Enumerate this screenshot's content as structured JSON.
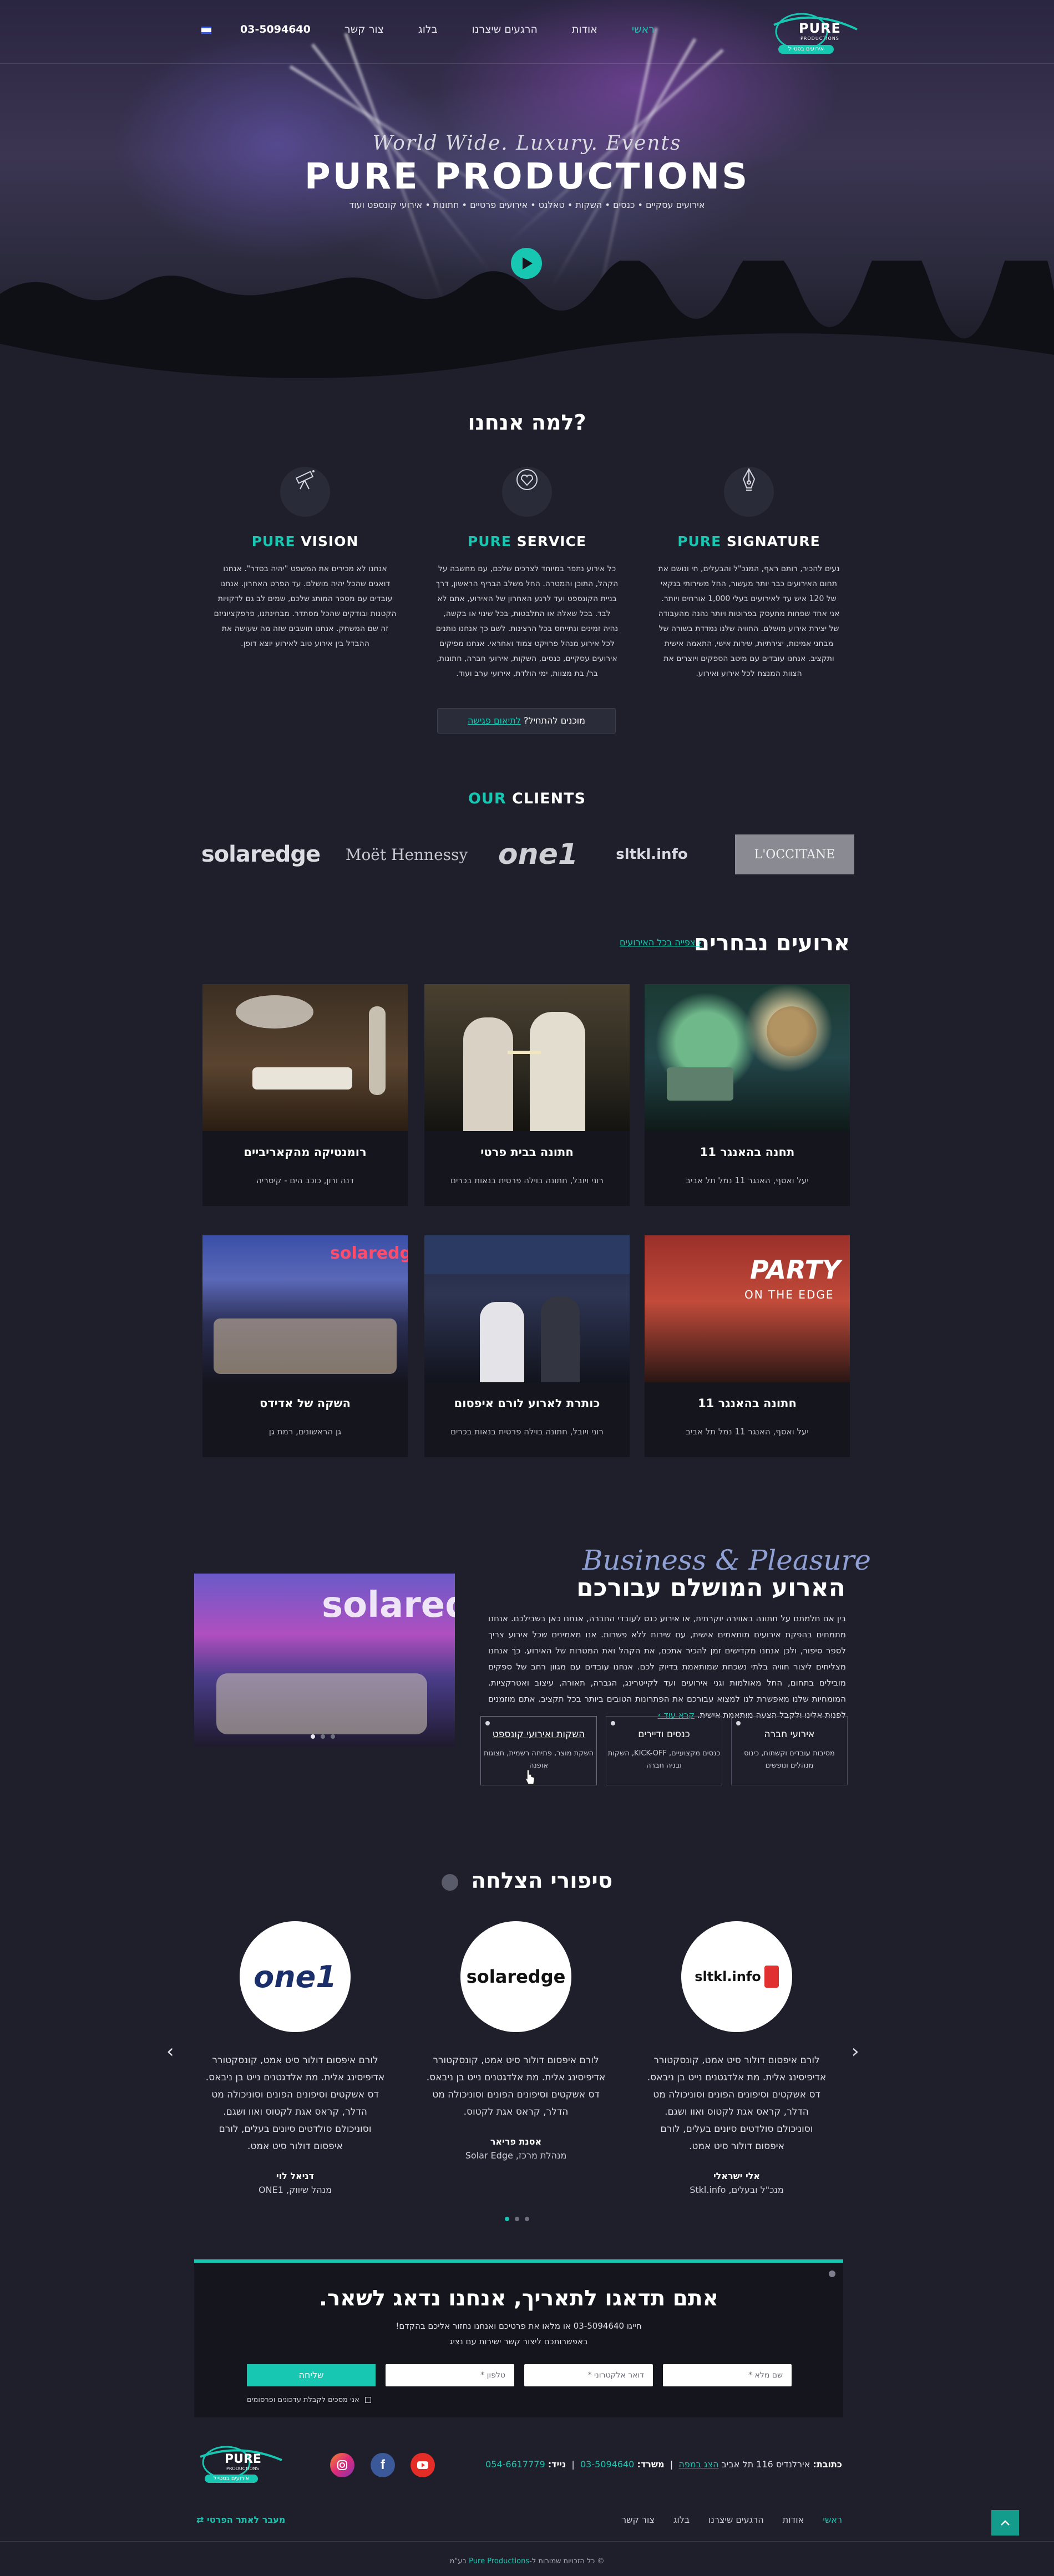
{
  "header": {
    "logo_alt": "Pure Productions",
    "logo_word": "PURE",
    "logo_sub": "PRODUCTIONS",
    "logo_tagline": "אירועים בסטייל",
    "nav": [
      "ראשי",
      "אודות",
      "הרגעים שיצרנו",
      "בלוג",
      "צור קשר"
    ],
    "phone": "03-5094640"
  },
  "hero": {
    "script": "World Wide. Luxury. Events",
    "title": "PURE PRODUCTIONS",
    "tags": "אירועים עסקיים • כנסים • השקות • טאלנט • אירועים פרטיים • חתונות • אירועי קונספט ועוד"
  },
  "why": {
    "title": "למה אנחנו?",
    "features": [
      {
        "name_accent": "PURE",
        "name_rest": "SIGNATURE",
        "icon": "pen-nib-icon",
        "text": "נעים להכיר, רותם ראף, המנכ\"ל והבעלים, חי ונושם את תחום האירועים כבר יותר מעשור, החל משירותי בנקאי של 120 איש עד לאירועים בעלי 1,000 אורחים ויותר. אני אחד שפחות מתעסק בפרוטות ויותר נהנה מהעבודה של יצירת אירוע מושלם. החוויה שלנו נמדדת בשורה של מבחני אמינות, יצירתיות, שירות אישי, התאמה אישית ותקציב. אנחנו עובדים עם מיטב הספקים ויוצרים את הצוות המנצח לכל אירוע ואירוע."
      },
      {
        "name_accent": "PURE",
        "name_rest": "SERVICE",
        "icon": "heart-gem-icon",
        "text": "כל אירוע נתפר במיוחד לצרכים שלכם, עם מחשבה על הקהל, התוכן והמטרה. החל משלב הבריף הראשון, דרך בניית הקונספט ועד לרגע האחרון של האירוע, אתם לא לבד. בכל שאלה או התלבטות, בכל שינוי או בקשה, נהיה זמינים ונתייחס בכל הרצינות. לשם כך אנחנו נותנים לכל אירוע מנהל פרויקט צמוד ואחראי. אנחנו מפיקים אירועים עסקיים, כנסים, השקות, אירועי חברה, חתונות, בר/ בת מצוות, ימי הולדת, אירועי ערב ועוד."
      },
      {
        "name_accent": "PURE",
        "name_rest": "VISION",
        "icon": "telescope-icon",
        "text": "אנחנו לא מכירים את המשפט \"יהיה בסדר\". אנחנו דואגים שהכל יהיה מושלם. עד הפרט האחרון. אנחנו עובדים עם מספר המותג שלכם, שמים לב גם לדקויות הקטנות ובודקים שהכל מסתדר. מבחינתנו, פרפקציוניזם זה שם המשחק. אנחנו חושבים שזה מה שעושה את ההבדל בין אירוע טוב לאירוע יוצא דופן."
      }
    ],
    "cta_prefix": "מוכנים להתחיל?",
    "cta_link": "לתיאום פגישה"
  },
  "clients": {
    "title_accent": "OUR",
    "title_rest": "CLIENTS",
    "logos": [
      "solaredge",
      "Moët Hennessy",
      "one1",
      "sltkl.info",
      "L'OCCITANE"
    ]
  },
  "events": {
    "title": "ארועים נבחרים",
    "view_all": "צפייה בכל האירועים ›",
    "items": [
      {
        "name": "תחנה בהאנגר 11",
        "location": "יעל ואסף, האנגר 11 נמל תל אביב"
      },
      {
        "name": "חתונה בבית פרטי",
        "location": "רוני ויובל, חתונה בוילה פרטית בנאות בכרים"
      },
      {
        "name": "רומנטיקה מהקאריביים",
        "location": "דנה ורון, כוכב הים - קיסריה"
      },
      {
        "name": "חתונה בהאנגר 11",
        "location": "יעל ואסף, האנגר 11 נמל תל אביב"
      },
      {
        "name": "כותרת לארוע לורם איפסום",
        "location": "רוני ויובל, חתונה בוילה פרטית בנאות בכרים"
      },
      {
        "name": "השקה של אדידס",
        "location": "גן הראשונים, רמת גן"
      }
    ]
  },
  "business": {
    "script": "Business & Pleasure",
    "title": "הארוע המושלם עבורכם",
    "text": "בין אם חלמתם על חתונה באווירה יוקרתית, או אירוע כנס לעובדי החברה, אנחנו כאן בשבילכם. אנחנו מתמחים בהפקת אירועים מותאמים אישית, עם שירות ללא פשרות. אנו מאמינים שכל אירוע צריך לספר סיפור, ולכן אנחנו מקדישים זמן להכיר אתכם, את הקהל ואת המטרות של האירוע. כך אנחנו מצליחים ליצור חוויה בלתי נשכחת שמותאמת בדיוק לכם. אנחנו עובדים עם מגוון רחב של ספקים מובילים בתחום, החל מאולמות וגני אירועים ועד לקייטרינג, הגברה, תאורה, עיצוב ואטרקציות. המומחיות שלנו מאפשרת לנו למצוא עבורכם את הפתרונות הטובים ביותר בכל תקציב. אתם מוזמנים לפנות אלינו ולקבל הצעה מותאמת אישית.",
    "more": "קרא עוד ›",
    "boxes": [
      {
        "title": "אירועי חברה",
        "text": "מסיבות עובדים וקשתות, כינוס מנהלים ונופשים"
      },
      {
        "title": "כנסים ודיירים",
        "text": "כנסים מקצועיים, KICK-OFF, השקות ובניה חברה"
      },
      {
        "title": "השקות ואירועי קונספט",
        "text": "השקת מוצר, פתיחה רשמית, תצוגות אופנה"
      }
    ]
  },
  "stories": {
    "title": "סיפורי הצלחה",
    "items": [
      {
        "logo": "sltkl.info",
        "quote": "לורם איפסום דולור סיט אמט, קונסקטורר אדיפיסינג אלית. מת אלדגטנים נייט בן ניבאס. דס אשקטים וסיפונים הפונים וסוניכולה מט הדלר, קראס אגת לקטוס ואוו ושגם. וסוניכולם סולדטים סיונים בעלים, לורם איפסום דולור סיט אמט.",
        "name": "אלי ישראלי",
        "role": "מנכ\"ל ובעלים, Stkl.info"
      },
      {
        "logo": "solaredge",
        "quote": "לורם איפסום דולור סיט אמט, קונסקטורר אדיפיסינג אלית. מת אלדגטנים נייט בן ניבאס. דס אשקטים וסיפונים הפונים וסוניכולה מט הדלר, קראס אגת לקטוס.",
        "name": "אסנת פריאר",
        "role": "מנהלת מרכז, Solar Edge"
      },
      {
        "logo": "one1",
        "quote": "לורם איפסום דולור סיט אמט, קונסקטורר אדיפיסינג אלית. מת אלדגטנים נייט בן ניבאס. דס אשקטים וסיפונים הפונים וסוניכולה מט הדלר, קראס אגת לקטוס ואוו ושגם. וסוניכולם סולדטים סיונים בעלים, לורם איפסום דולור סיט אמט.",
        "name": "דניאל לוי",
        "role": "מנהל שיווק, ONE1"
      }
    ]
  },
  "contact": {
    "title": "אתם תדאגו לתאריך, אנחנו נדאג לשאר.",
    "line1": "חייגו 03-5094640 או מלאו את פרטיכם ואנחנו נחזור אליכם בהקדם!",
    "line2": "באפשרותכם ליצור קשר ישירות עם נציג",
    "placeholders": {
      "name": "שם מלא *",
      "email": "דואר אלקטרוני *",
      "phone": "טלפון *"
    },
    "send": "שליחה",
    "agree": "אני מסכים לקבלת עדכונים ופרסומים"
  },
  "footer": {
    "address_label": "כתובת:",
    "address": "אירלנדיס 116 תל אביב",
    "map_link": "הצג במפה",
    "office_label": "משרד:",
    "office": "03-5094640",
    "mobile_label": "נייד:",
    "mobile": "054-6617779",
    "nav": [
      "ראשי",
      "אודות",
      "הרגעים שיצרנו",
      "בלוג",
      "צור קשר"
    ],
    "privacy": "מעבר לאתר הפרטי ⇄",
    "copyright_prefix": "© כל הזכויות שמורות ל-",
    "copyright_brand": "Pure Productions",
    "copyright_suffix": " בע\"מ"
  },
  "colors": {
    "accent": "#17c7b2",
    "background": "#1e1f2a",
    "card": "#15161d"
  }
}
